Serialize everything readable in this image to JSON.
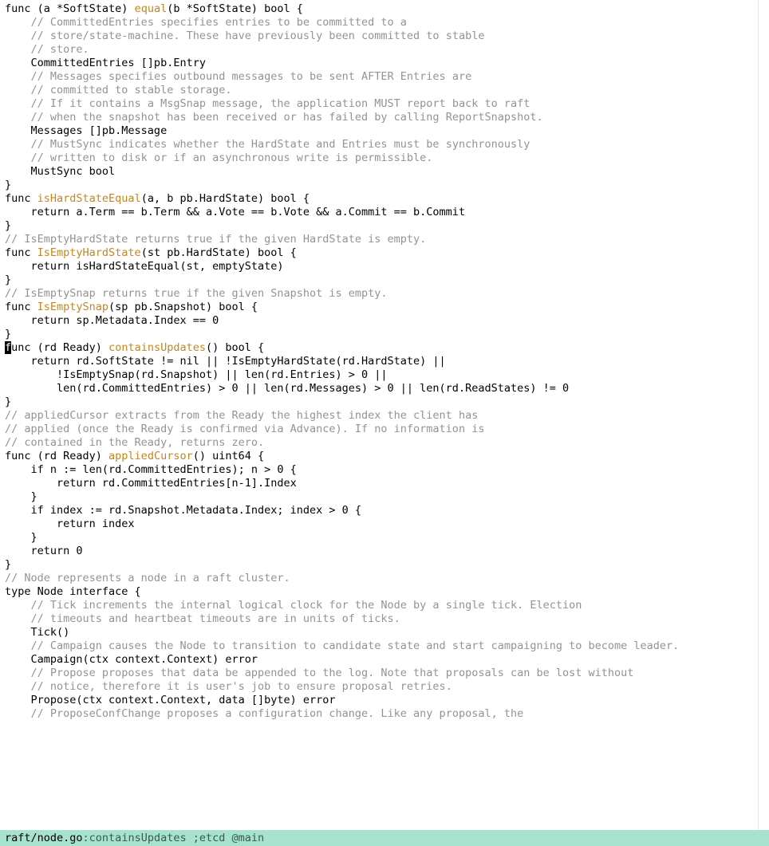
{
  "statusbar": {
    "file": "raft/node.go",
    "tail": ":containsUpdates ;etcd @main"
  },
  "ruler_col": 116,
  "code": [
    {
      "segs": [
        {
          "c": "txt",
          "t": "func (a *SoftState) "
        },
        {
          "c": "fn",
          "t": "equal"
        },
        {
          "c": "txt",
          "t": "(b *SoftState) bool {"
        }
      ]
    },
    {
      "segs": [
        {
          "c": "txt",
          "t": "    "
        },
        {
          "c": "cmt",
          "t": "// CommittedEntries specifies entries to be committed to a"
        }
      ]
    },
    {
      "segs": [
        {
          "c": "txt",
          "t": "    "
        },
        {
          "c": "cmt",
          "t": "// store/state-machine. These have previously been committed to stable"
        }
      ]
    },
    {
      "segs": [
        {
          "c": "txt",
          "t": "    "
        },
        {
          "c": "cmt",
          "t": "// store."
        }
      ]
    },
    {
      "segs": [
        {
          "c": "txt",
          "t": "    CommittedEntries []pb.Entry"
        }
      ]
    },
    {
      "segs": [
        {
          "c": "txt",
          "t": ""
        }
      ]
    },
    {
      "segs": [
        {
          "c": "txt",
          "t": "    "
        },
        {
          "c": "cmt",
          "t": "// Messages specifies outbound messages to be sent AFTER Entries are"
        }
      ]
    },
    {
      "segs": [
        {
          "c": "txt",
          "t": "    "
        },
        {
          "c": "cmt",
          "t": "// committed to stable storage."
        }
      ]
    },
    {
      "segs": [
        {
          "c": "txt",
          "t": "    "
        },
        {
          "c": "cmt",
          "t": "// If it contains a MsgSnap message, the application MUST report back to raft"
        }
      ]
    },
    {
      "segs": [
        {
          "c": "txt",
          "t": "    "
        },
        {
          "c": "cmt",
          "t": "// when the snapshot has been received or has failed by calling ReportSnapshot."
        }
      ]
    },
    {
      "segs": [
        {
          "c": "txt",
          "t": "    Messages []pb.Message"
        }
      ]
    },
    {
      "segs": [
        {
          "c": "txt",
          "t": ""
        }
      ]
    },
    {
      "segs": [
        {
          "c": "txt",
          "t": "    "
        },
        {
          "c": "cmt",
          "t": "// MustSync indicates whether the HardState and Entries must be synchronously"
        }
      ]
    },
    {
      "segs": [
        {
          "c": "txt",
          "t": "    "
        },
        {
          "c": "cmt",
          "t": "// written to disk or if an asynchronous write is permissible."
        }
      ]
    },
    {
      "segs": [
        {
          "c": "txt",
          "t": "    MustSync bool"
        }
      ]
    },
    {
      "segs": [
        {
          "c": "txt",
          "t": "}"
        }
      ]
    },
    {
      "segs": [
        {
          "c": "txt",
          "t": ""
        }
      ]
    },
    {
      "segs": [
        {
          "c": "txt",
          "t": "func "
        },
        {
          "c": "fn",
          "t": "isHardStateEqual"
        },
        {
          "c": "txt",
          "t": "(a, b pb.HardState) bool {"
        }
      ]
    },
    {
      "segs": [
        {
          "c": "txt",
          "t": "    return a.Term == b.Term && a.Vote == b.Vote && a.Commit == b.Commit"
        }
      ]
    },
    {
      "segs": [
        {
          "c": "txt",
          "t": "}"
        }
      ]
    },
    {
      "segs": [
        {
          "c": "txt",
          "t": ""
        }
      ]
    },
    {
      "segs": [
        {
          "c": "cmt",
          "t": "// IsEmptyHardState returns true if the given HardState is empty."
        }
      ]
    },
    {
      "segs": [
        {
          "c": "txt",
          "t": "func "
        },
        {
          "c": "fn",
          "t": "IsEmptyHardState"
        },
        {
          "c": "txt",
          "t": "(st pb.HardState) bool {"
        }
      ]
    },
    {
      "segs": [
        {
          "c": "txt",
          "t": "    return isHardStateEqual(st, emptyState)"
        }
      ]
    },
    {
      "segs": [
        {
          "c": "txt",
          "t": "}"
        }
      ]
    },
    {
      "segs": [
        {
          "c": "txt",
          "t": ""
        }
      ]
    },
    {
      "segs": [
        {
          "c": "cmt",
          "t": "// IsEmptySnap returns true if the given Snapshot is empty."
        }
      ]
    },
    {
      "segs": [
        {
          "c": "txt",
          "t": "func "
        },
        {
          "c": "fn",
          "t": "IsEmptySnap"
        },
        {
          "c": "txt",
          "t": "(sp pb.Snapshot) bool {"
        }
      ]
    },
    {
      "segs": [
        {
          "c": "txt",
          "t": "    return sp.Metadata.Index == 0"
        }
      ]
    },
    {
      "segs": [
        {
          "c": "txt",
          "t": "}"
        }
      ]
    },
    {
      "segs": [
        {
          "c": "txt",
          "t": ""
        }
      ]
    },
    {
      "cursor_on_first": true,
      "segs": [
        {
          "c": "txt",
          "t": "func (rd Ready) "
        },
        {
          "c": "fn",
          "t": "containsUpdates"
        },
        {
          "c": "txt",
          "t": "() bool {"
        }
      ]
    },
    {
      "segs": [
        {
          "c": "txt",
          "t": "    return rd.SoftState != nil || !IsEmptyHardState(rd.HardState) ||"
        }
      ]
    },
    {
      "segs": [
        {
          "c": "txt",
          "t": "        !IsEmptySnap(rd.Snapshot) || len(rd.Entries) > 0 ||"
        }
      ]
    },
    {
      "segs": [
        {
          "c": "txt",
          "t": "        len(rd.CommittedEntries) > 0 || len(rd.Messages) > 0 || len(rd.ReadStates) != 0"
        }
      ]
    },
    {
      "segs": [
        {
          "c": "txt",
          "t": "}"
        }
      ]
    },
    {
      "segs": [
        {
          "c": "txt",
          "t": ""
        }
      ]
    },
    {
      "segs": [
        {
          "c": "cmt",
          "t": "// appliedCursor extracts from the Ready the highest index the client has"
        }
      ]
    },
    {
      "segs": [
        {
          "c": "cmt",
          "t": "// applied (once the Ready is confirmed via Advance). If no information is"
        }
      ]
    },
    {
      "segs": [
        {
          "c": "cmt",
          "t": "// contained in the Ready, returns zero."
        }
      ]
    },
    {
      "segs": [
        {
          "c": "txt",
          "t": "func (rd Ready) "
        },
        {
          "c": "fn",
          "t": "appliedCursor"
        },
        {
          "c": "txt",
          "t": "() uint64 {"
        }
      ]
    },
    {
      "segs": [
        {
          "c": "txt",
          "t": "    if n := len(rd.CommittedEntries); n > 0 {"
        }
      ]
    },
    {
      "segs": [
        {
          "c": "txt",
          "t": "        return rd.CommittedEntries[n-1].Index"
        }
      ]
    },
    {
      "segs": [
        {
          "c": "txt",
          "t": "    }"
        }
      ]
    },
    {
      "segs": [
        {
          "c": "txt",
          "t": "    if index := rd.Snapshot.Metadata.Index; index > 0 {"
        }
      ]
    },
    {
      "segs": [
        {
          "c": "txt",
          "t": "        return index"
        }
      ]
    },
    {
      "segs": [
        {
          "c": "txt",
          "t": "    }"
        }
      ]
    },
    {
      "segs": [
        {
          "c": "txt",
          "t": "    return 0"
        }
      ]
    },
    {
      "segs": [
        {
          "c": "txt",
          "t": "}"
        }
      ]
    },
    {
      "segs": [
        {
          "c": "txt",
          "t": ""
        }
      ]
    },
    {
      "segs": [
        {
          "c": "cmt",
          "t": "// Node represents a node in a raft cluster."
        }
      ]
    },
    {
      "segs": [
        {
          "c": "txt",
          "t": "type Node interface {"
        }
      ]
    },
    {
      "segs": [
        {
          "c": "txt",
          "t": "    "
        },
        {
          "c": "cmt",
          "t": "// Tick increments the internal logical clock for the Node by a single tick. Election"
        }
      ]
    },
    {
      "segs": [
        {
          "c": "txt",
          "t": "    "
        },
        {
          "c": "cmt",
          "t": "// timeouts and heartbeat timeouts are in units of ticks."
        }
      ]
    },
    {
      "segs": [
        {
          "c": "txt",
          "t": "    Tick()"
        }
      ]
    },
    {
      "segs": [
        {
          "c": "txt",
          "t": "    "
        },
        {
          "c": "cmt",
          "t": "// Campaign causes the Node to transition to candidate state and start campaigning to become leader."
        }
      ]
    },
    {
      "segs": [
        {
          "c": "txt",
          "t": "    Campaign(ctx context.Context) error"
        }
      ]
    },
    {
      "segs": [
        {
          "c": "txt",
          "t": "    "
        },
        {
          "c": "cmt",
          "t": "// Propose proposes that data be appended to the log. Note that proposals can be lost without"
        }
      ]
    },
    {
      "segs": [
        {
          "c": "txt",
          "t": "    "
        },
        {
          "c": "cmt",
          "t": "// notice, therefore it is user's job to ensure proposal retries."
        }
      ]
    },
    {
      "segs": [
        {
          "c": "txt",
          "t": "    Propose(ctx context.Context, data []byte) error"
        }
      ]
    },
    {
      "segs": [
        {
          "c": "txt",
          "t": "    "
        },
        {
          "c": "cmt",
          "t": "// ProposeConfChange proposes a configuration change. Like any proposal, the"
        }
      ]
    }
  ]
}
